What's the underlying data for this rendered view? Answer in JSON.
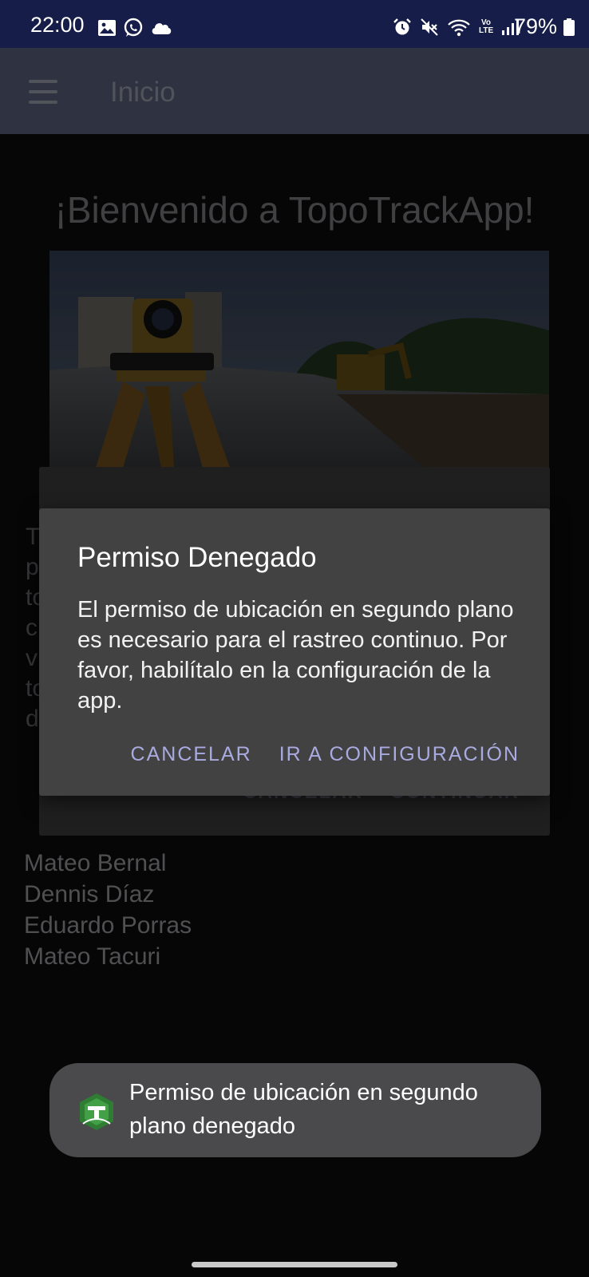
{
  "status_bar": {
    "time": "22:00",
    "battery": "79%",
    "left_icons": [
      "image-icon",
      "whatsapp-icon",
      "cloud-icon"
    ],
    "right_icons": [
      "alarm-icon",
      "mute-icon",
      "wifi-icon",
      "volte-icon",
      "signal-icon",
      "battery-icon"
    ],
    "volte_text": "Vo LTE"
  },
  "app_bar": {
    "title": "Inicio"
  },
  "page": {
    "welcome": "¡Bienvenido a TopoTrackApp!",
    "team_members": [
      "Mateo Bernal",
      "Dennis Díaz",
      "Eduardo Porras",
      "Mateo Tacuri"
    ]
  },
  "background_dialog": {
    "cancel_label": "CANCELAR",
    "continue_label": "CONTINUAR"
  },
  "dialog": {
    "title": "Permiso Denegado",
    "message": "El permiso de ubicación en segundo plano es necesario para el rastreo continuo. Por favor, habilítalo en la configuración de la app.",
    "cancel_label": "CANCELAR",
    "settings_label": "IR A CONFIGURACIÓN"
  },
  "toast": {
    "text": "Permiso de ubicación en segundo plano denegado"
  },
  "colors": {
    "status_bar": "#151d48",
    "app_bar": "#52566f",
    "dialog_bg": "#424243",
    "dialog_accent": "#a9abe0",
    "toast_bg": "#4a4a4c",
    "app_icon_green": "#2e7d32"
  }
}
